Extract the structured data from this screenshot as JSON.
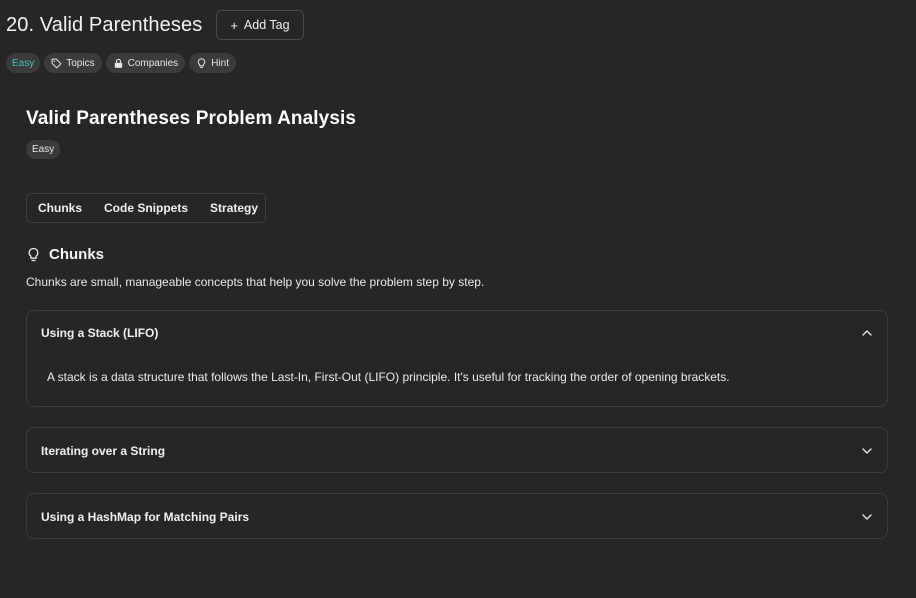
{
  "header": {
    "title": "20. Valid Parentheses",
    "add_tag_label": "Add Tag",
    "add_tag_icon": "+"
  },
  "tags": [
    {
      "label": "Easy",
      "icon": null,
      "color": "#3cc3b3"
    },
    {
      "label": "Topics",
      "icon": "tag-icon"
    },
    {
      "label": "Companies",
      "icon": "lock-icon"
    },
    {
      "label": "Hint",
      "icon": "lightbulb-icon"
    }
  ],
  "analysis": {
    "title": "Valid Parentheses Problem Analysis",
    "difficulty": "Easy"
  },
  "tabs": [
    "Chunks",
    "Code Snippets",
    "Strategy"
  ],
  "chunks": {
    "title": "Chunks",
    "icon": "lightbulb-icon",
    "description": "Chunks are small, manageable concepts that help you solve the problem step by step.",
    "items": [
      {
        "label": "Using a Stack (LIFO)",
        "expanded": true,
        "body": "A stack is a data structure that follows the Last-In, First-Out (LIFO) principle. It's useful for tracking the order of opening brackets."
      },
      {
        "label": "Iterating over a String",
        "expanded": false
      },
      {
        "label": "Using a HashMap for Matching Pairs",
        "expanded": false
      }
    ]
  },
  "colors": {
    "background": "#262626",
    "easy_accent": "#3cc3b3",
    "pill": "#3b3b3b",
    "border": "#3c3c3c"
  }
}
